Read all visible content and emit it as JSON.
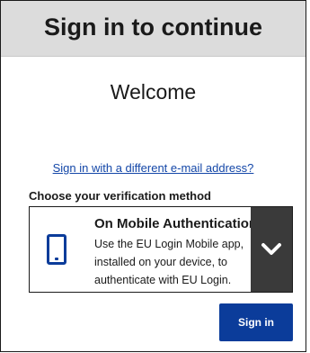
{
  "header": {
    "title": "Sign in to continue"
  },
  "welcome": {
    "text": "Welcome"
  },
  "alt_signin_link": "Sign in with a different e-mail address?",
  "verification": {
    "label": "Choose your verification method",
    "selected": {
      "icon": "mobile-phone-icon",
      "title": "On Mobile Authentication",
      "description": "Use the EU Login Mobile app, installed on your device, to authenticate with EU Login."
    },
    "toggle_icon": "chevron-down-icon"
  },
  "actions": {
    "sign_in_label": "Sign in"
  },
  "colors": {
    "brand_blue": "#0b3c9a",
    "link_blue": "#1447a8",
    "header_bg": "#dcdcdc",
    "toggle_bg": "#3a3a3a"
  }
}
